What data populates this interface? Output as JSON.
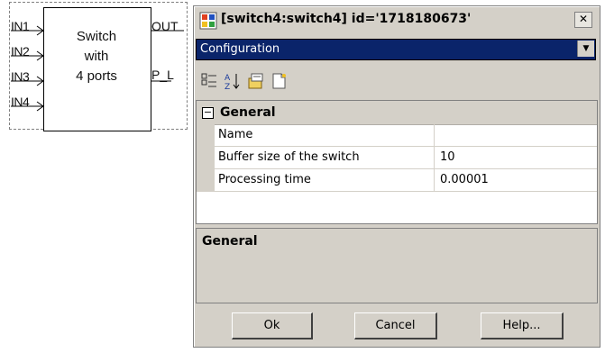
{
  "block": {
    "name_lines": [
      "Switch",
      "with",
      "4 ports"
    ],
    "inputs": [
      "IN1",
      "IN2",
      "IN3",
      "IN4"
    ],
    "outputs": [
      "OUT",
      "P_L"
    ]
  },
  "dialog": {
    "title": "[switch4:switch4] id='1718180673'",
    "close_label": "✕",
    "object_select": "Configuration",
    "toolbar_icons": [
      "categorized-icon",
      "alphabetical-icon",
      "property-pages-icon",
      "new-page-icon"
    ],
    "category": {
      "label": "General",
      "collapse_symbol": "⊟"
    },
    "properties": [
      {
        "name": "Name",
        "value": ""
      },
      {
        "name": "Buffer size of the switch",
        "value": "10"
      },
      {
        "name": "Processing time",
        "value": "0.00001"
      }
    ],
    "description_title": "General",
    "buttons": {
      "ok": "Ok",
      "cancel": "Cancel",
      "help": "Help..."
    }
  },
  "colors": {
    "dialog_bg": "#d4d0c8",
    "select_bg": "#0a246a"
  }
}
